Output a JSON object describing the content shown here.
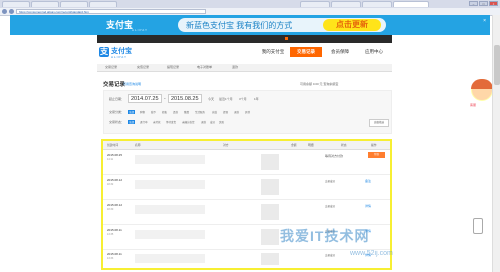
{
  "browser": {
    "tabs": [
      "",
      "",
      "",
      "",
      "",
      "",
      "",
      ""
    ],
    "url": "https://consumeprod.alipay.com/record/standard.htm",
    "win_btns": [
      "–",
      "□",
      "×"
    ]
  },
  "banner": {
    "logo": "支付宝",
    "logo_en": "ALIPAY",
    "slogan": "新蓝色支付宝  我有我们的方式",
    "cta": "点击更新",
    "close": "×"
  },
  "topbar": {
    "items": [
      "",
      "",
      "",
      "",
      "",
      ""
    ]
  },
  "header": {
    "logo_mark": "支",
    "logo_text": "支付宝",
    "logo_sub": "ALIPAY",
    "nav": [
      "我的支付宝",
      "交易记录",
      "会员保障",
      "应用中心"
    ]
  },
  "subnav": {
    "items": [
      "交易记录",
      "充值记录",
      "提现记录",
      "电子对账单",
      "退款"
    ]
  },
  "page": {
    "title": "交易记录",
    "title_link": "可用查询说明",
    "balance": "可用余额 0.00 元  查询余额宝"
  },
  "filter": {
    "time_label": "起止日期：",
    "date_from": "2014.07.25",
    "date_sep": "-",
    "date_to": "2015.08.25",
    "quick": [
      "今天",
      "最近1个月",
      "3个月",
      "1年"
    ],
    "type_label": "交易分类：",
    "type_opts": [
      "全部",
      "购物",
      "线下",
      "转账",
      "还款",
      "缴费",
      "生活服务",
      "充值",
      "提现",
      "退款",
      "其他"
    ],
    "status_label": "交易状态：",
    "status_opts": [
      "全部",
      "进行中",
      "未付款",
      "等待发货",
      "未确认收货",
      "退款",
      "成功",
      "失败"
    ],
    "advanced": "高级筛选"
  },
  "table": {
    "headers": [
      "创建时间",
      "名称",
      "对方",
      "金额",
      "明细",
      "状态",
      "操作"
    ],
    "rows": [
      {
        "date": "2015.08.25",
        "time": "14:11",
        "status": "等待对方付款",
        "action": "付款"
      },
      {
        "date": "2015.08.12",
        "time": "18:32",
        "status": "交易成功",
        "action": "备注"
      },
      {
        "date": "2015.08.12",
        "time": "18:30",
        "status": "交易成功",
        "action": "详情"
      },
      {
        "date": "2015.08.11",
        "time": "13:35",
        "status": "交易成功",
        "action": "详情"
      },
      {
        "date": "2015.08.11",
        "time": "13:33",
        "status": "交易成功",
        "action": "详情"
      }
    ]
  },
  "side": {
    "label": "客服"
  },
  "watermark": {
    "text": "我爱IT技术网",
    "url": "www.52ij.com"
  }
}
